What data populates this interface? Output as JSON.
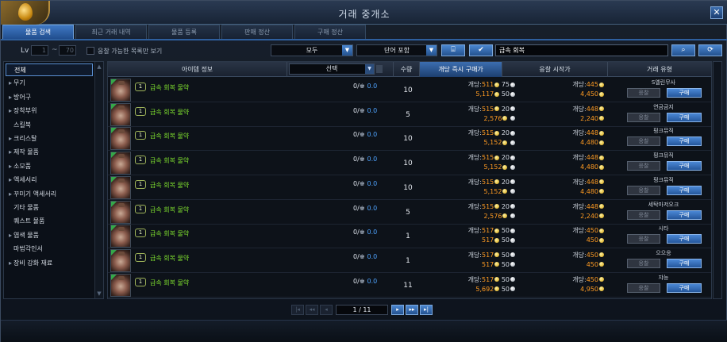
{
  "window": {
    "title": "거래 중개소",
    "close_symbol": "✕"
  },
  "tabs": [
    {
      "label": "물품 검색",
      "active": true
    },
    {
      "label": "최근 거래 내역",
      "active": false
    },
    {
      "label": "물품 등록",
      "active": false
    },
    {
      "label": "판매 정산",
      "active": false
    },
    {
      "label": "구매 정산",
      "active": false
    }
  ],
  "filters": {
    "lv_label": "Lv",
    "lv_min": "1",
    "lv_tilde": "~",
    "lv_max": "70",
    "bid_only_label": "응찰 가능한 목록만 보기",
    "grade_select": "모두",
    "match_select": "단어 포함",
    "search_value": "급속 회복"
  },
  "categories": [
    {
      "label": "전체",
      "active": true,
      "expand": ""
    },
    {
      "label": "무기",
      "expand": "▸"
    },
    {
      "label": "방어구",
      "expand": "▸"
    },
    {
      "label": "장착부위",
      "expand": "▸"
    },
    {
      "label": "스킬북",
      "expand": ""
    },
    {
      "label": "크리스탈",
      "expand": "▸"
    },
    {
      "label": "제작 물품",
      "expand": "▸"
    },
    {
      "label": "소모품",
      "expand": "▸"
    },
    {
      "label": "액세서리",
      "expand": "▸"
    },
    {
      "label": "꾸미기 액세서리",
      "expand": "▸"
    },
    {
      "label": "기타 물품",
      "expand": ""
    },
    {
      "label": "퀘스트 물품",
      "expand": ""
    },
    {
      "label": "염색 물품",
      "expand": "▸"
    },
    {
      "label": "마법각인서",
      "expand": ""
    },
    {
      "label": "장비 강화 재료",
      "expand": "▸"
    }
  ],
  "table": {
    "headers": {
      "item_info": "아이템 정보",
      "select": "선택",
      "qty": "수량",
      "buyout": "개당 즉시 구매가",
      "bid_start": "응찰 시작가",
      "trade_type": "거래 유형"
    },
    "rows": [
      {
        "level": "1",
        "name": "급속 회복 물약",
        "bids": "0/",
        "bid_value": "0.0",
        "qty": "10",
        "unit_buy_label": "개당:",
        "unit_buy_gold": "511",
        "unit_buy_silver": "75",
        "total_buy_gold": "5,117",
        "total_buy_silver": "50",
        "unit_bid_label": "개당:",
        "unit_bid_gold": "445",
        "total_bid_gold": "4,450",
        "seller": "S엘린무사",
        "bid_btn": "응찰",
        "buy_btn": "구매"
      },
      {
        "level": "1",
        "name": "급속 회복 물약",
        "bids": "0/",
        "bid_value": "0.0",
        "qty": "5",
        "unit_buy_label": "개당:",
        "unit_buy_gold": "515",
        "unit_buy_silver": "20",
        "total_buy_gold": "2,576",
        "total_buy_silver": "",
        "unit_bid_label": "개당:",
        "unit_bid_gold": "448",
        "total_bid_gold": "2,240",
        "seller": "연금금지",
        "bid_btn": "응찰",
        "buy_btn": "구매"
      },
      {
        "level": "1",
        "name": "급속 회복 물약",
        "bids": "0/",
        "bid_value": "0.0",
        "qty": "10",
        "unit_buy_label": "개당:",
        "unit_buy_gold": "515",
        "unit_buy_silver": "20",
        "total_buy_gold": "5,152",
        "total_buy_silver": "",
        "unit_bid_label": "개당:",
        "unit_bid_gold": "448",
        "total_bid_gold": "4,480",
        "seller": "핑크뮤직",
        "bid_btn": "응찰",
        "buy_btn": "구매"
      },
      {
        "level": "1",
        "name": "급속 회복 물약",
        "bids": "0/",
        "bid_value": "0.0",
        "qty": "10",
        "unit_buy_label": "개당:",
        "unit_buy_gold": "515",
        "unit_buy_silver": "20",
        "total_buy_gold": "5,152",
        "total_buy_silver": "",
        "unit_bid_label": "개당:",
        "unit_bid_gold": "448",
        "total_bid_gold": "4,480",
        "seller": "핑크뮤직",
        "bid_btn": "응찰",
        "buy_btn": "구매"
      },
      {
        "level": "1",
        "name": "급속 회복 물약",
        "bids": "0/",
        "bid_value": "0.0",
        "qty": "10",
        "unit_buy_label": "개당:",
        "unit_buy_gold": "515",
        "unit_buy_silver": "20",
        "total_buy_gold": "5,152",
        "total_buy_silver": "",
        "unit_bid_label": "개당:",
        "unit_bid_gold": "448",
        "total_bid_gold": "4,480",
        "seller": "핑크뮤직",
        "bid_btn": "응찰",
        "buy_btn": "구매"
      },
      {
        "level": "1",
        "name": "급속 회복 물약",
        "bids": "0/",
        "bid_value": "0.0",
        "qty": "5",
        "unit_buy_label": "개당:",
        "unit_buy_gold": "515",
        "unit_buy_silver": "20",
        "total_buy_gold": "2,576",
        "total_buy_silver": "",
        "unit_bid_label": "개당:",
        "unit_bid_gold": "448",
        "total_bid_gold": "2,240",
        "seller": "세탁마저오크",
        "bid_btn": "응찰",
        "buy_btn": "구매"
      },
      {
        "level": "1",
        "name": "급속 회복 물약",
        "bids": "0/",
        "bid_value": "0.0",
        "qty": "1",
        "unit_buy_label": "개당:",
        "unit_buy_gold": "517",
        "unit_buy_silver": "50",
        "total_buy_gold": "517",
        "total_buy_silver": "50",
        "unit_bid_label": "개당:",
        "unit_bid_gold": "450",
        "total_bid_gold": "450",
        "seller": "시타",
        "bid_btn": "응찰",
        "buy_btn": "구매"
      },
      {
        "level": "1",
        "name": "급속 회복 물약",
        "bids": "0/",
        "bid_value": "0.0",
        "qty": "1",
        "unit_buy_label": "개당:",
        "unit_buy_gold": "517",
        "unit_buy_silver": "50",
        "total_buy_gold": "517",
        "total_buy_silver": "50",
        "unit_bid_label": "개당:",
        "unit_bid_gold": "450",
        "total_bid_gold": "450",
        "seller": "으으응",
        "bid_btn": "응찰",
        "buy_btn": "구매"
      },
      {
        "level": "1",
        "name": "급속 회복 물약",
        "bids": "0/",
        "bid_value": "0.0",
        "qty": "11",
        "unit_buy_label": "개당:",
        "unit_buy_gold": "517",
        "unit_buy_silver": "50",
        "total_buy_gold": "5,692",
        "total_buy_silver": "50",
        "unit_bid_label": "개당:",
        "unit_bid_gold": "450",
        "total_bid_gold": "4,950",
        "seller": "쟈능",
        "bid_btn": "응찰",
        "buy_btn": "구매"
      }
    ]
  },
  "pagination": {
    "current": "1 / 11",
    "first": "|◂",
    "prev_fast": "◂◂",
    "prev": "◂",
    "next": "▸",
    "next_fast": "▸▸",
    "last": "▸|"
  },
  "icons": {
    "search": "search-icon",
    "refresh": "refresh-icon",
    "filter": "filter-icon",
    "check": "check-icon"
  },
  "colors": {
    "accent": "#2e5f9e",
    "item_name": "#7fe02e",
    "price": "#ff9b22",
    "bid_value": "#4fa4ff"
  }
}
